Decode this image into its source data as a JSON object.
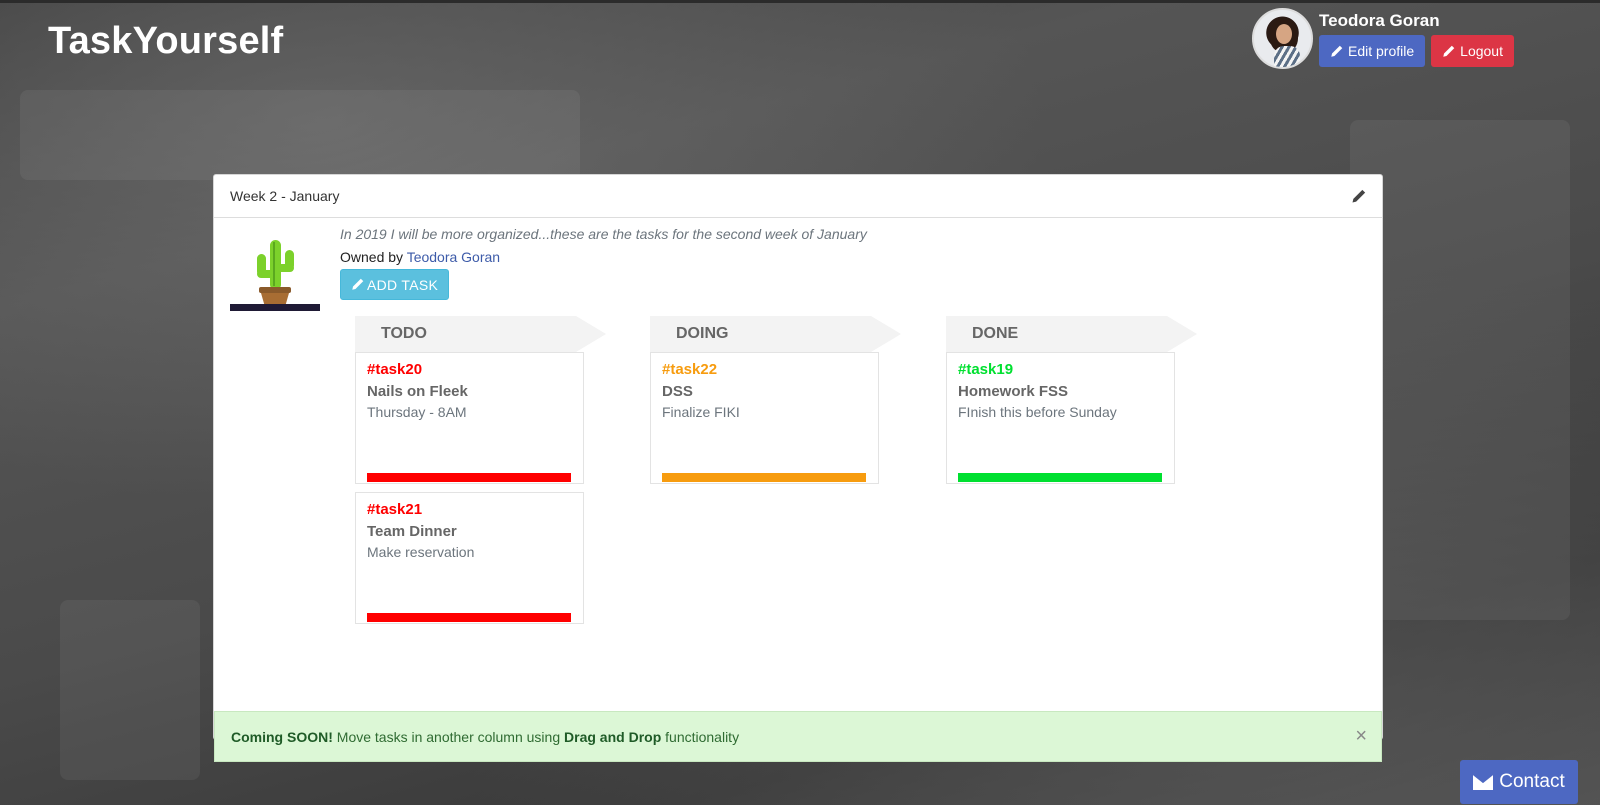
{
  "app": {
    "brand": "TaskYourself"
  },
  "user": {
    "name": "Teodora Goran",
    "edit_label": "Edit profile",
    "logout_label": "Logout"
  },
  "board": {
    "title": "Week 2 - January",
    "description": "In 2019 I will be more organized...these are the tasks for the second week of January",
    "owned_prefix": "Owned by",
    "owner": "Teodora Goran",
    "add_task_label": "ADD TASK",
    "columns": [
      {
        "name": "TODO",
        "color": "#ff0000",
        "tasks": [
          {
            "id": "#task20",
            "title": "Nails on Fleek",
            "desc": "Thursday - 8AM"
          },
          {
            "id": "#task21",
            "title": "Team Dinner",
            "desc": "Make reservation"
          }
        ]
      },
      {
        "name": "DOING",
        "color": "#f79c0f",
        "tasks": [
          {
            "id": "#task22",
            "title": "DSS",
            "desc": "Finalize FIKI"
          }
        ]
      },
      {
        "name": "DONE",
        "color": "#00e030",
        "tasks": [
          {
            "id": "#task19",
            "title": "Homework FSS",
            "desc": "FInish this before Sunday"
          }
        ]
      }
    ]
  },
  "alert": {
    "strong_prefix": "Coming SOON!",
    "text_mid": " Move tasks in another column using ",
    "strong_feature": "Drag and Drop",
    "text_end": " functionality",
    "close_symbol": "×"
  },
  "contact": {
    "label": "Contact"
  },
  "icons": {
    "edit": "pencil-icon",
    "close": "close-icon",
    "contact": "envelope-icon"
  }
}
